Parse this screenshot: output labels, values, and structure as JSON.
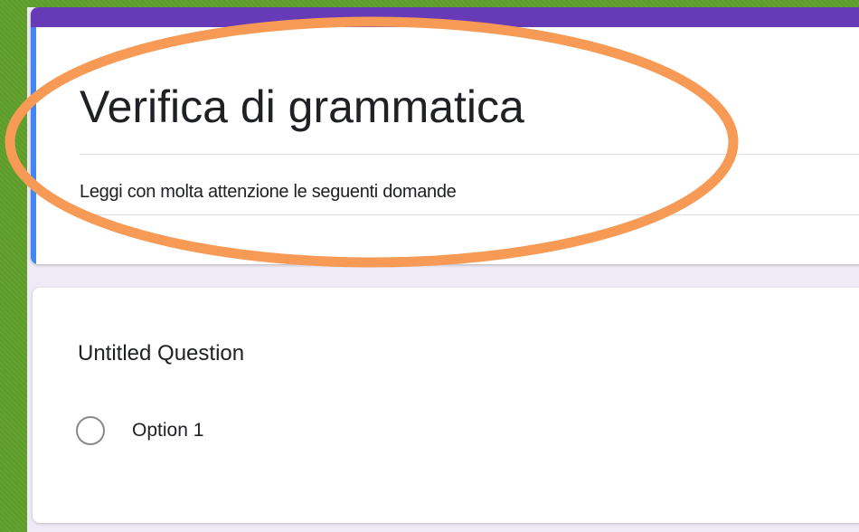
{
  "form": {
    "title": "Verifica di grammatica",
    "description": "Leggi con molta attenzione le seguenti domande"
  },
  "question": {
    "title": "Untitled Question",
    "options": [
      {
        "label": "Option 1",
        "selected": false
      }
    ]
  },
  "colors": {
    "theme_purple": "#673ab7",
    "focus_blue": "#4285f4",
    "highlight_orange": "#f79a56",
    "canvas_background": "#efebf6",
    "outer_background_green": "#5f9d2a"
  },
  "icons": {
    "radio": "radio-unchecked-icon"
  },
  "annotation": {
    "shape": "ellipse",
    "color": "#f79a56",
    "highlights": "form-header"
  }
}
